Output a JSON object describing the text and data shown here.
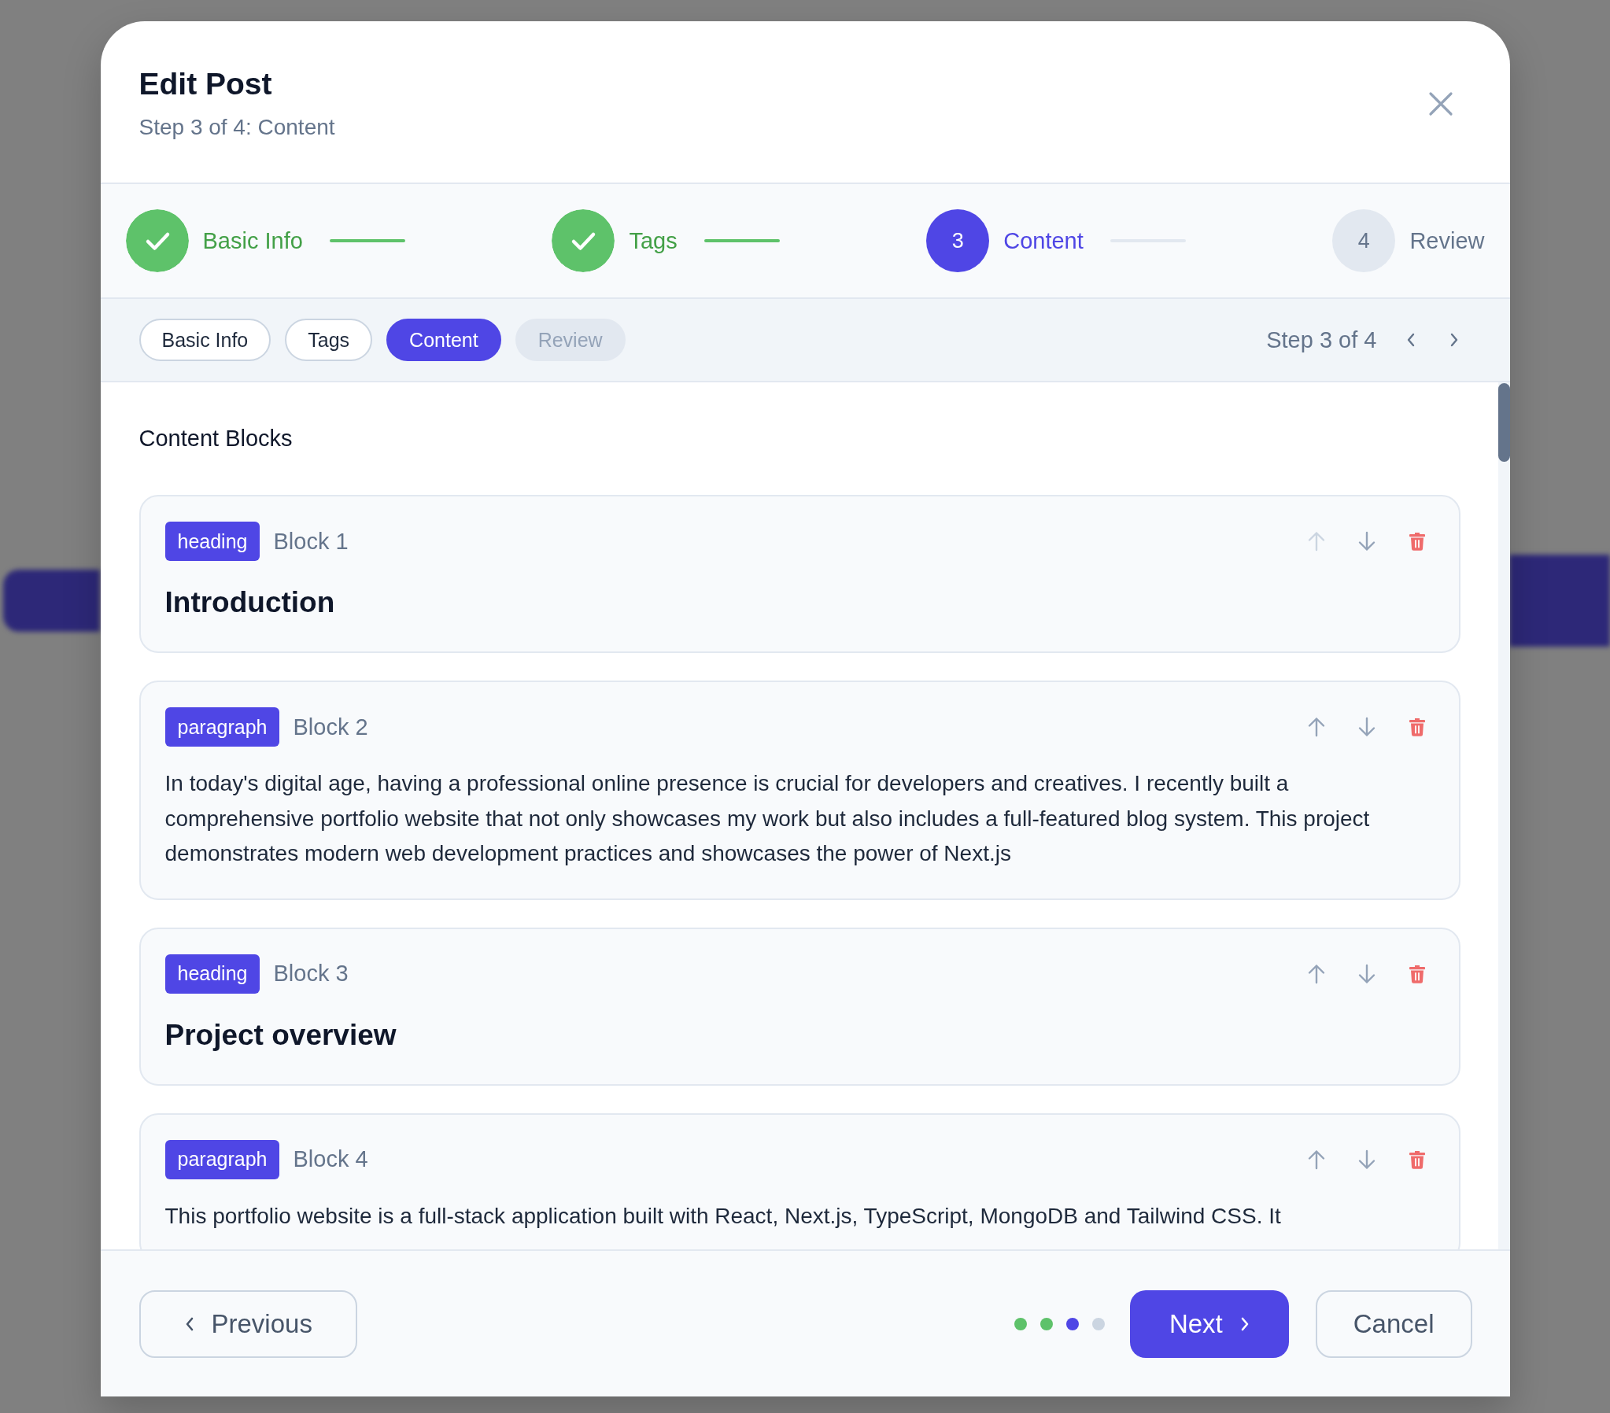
{
  "dialog": {
    "title": "Edit Post",
    "subtitle": "Step 3 of 4: Content"
  },
  "steps": [
    {
      "label": "Basic Info",
      "kind": "completed"
    },
    {
      "label": "Tags",
      "kind": "completed"
    },
    {
      "label": "Content",
      "kind": "current",
      "number": "3"
    },
    {
      "label": "Review",
      "kind": "upcoming",
      "number": "4"
    }
  ],
  "step_tabs": [
    {
      "label": "Basic Info",
      "selected": false,
      "disabled": false
    },
    {
      "label": "Tags",
      "selected": false,
      "disabled": false
    },
    {
      "label": "Content",
      "selected": true,
      "disabled": false
    },
    {
      "label": "Review",
      "selected": false,
      "disabled": true
    }
  ],
  "step_counter": "Step 3 of 4",
  "content": {
    "heading": "Content Blocks",
    "blocks": [
      {
        "kind": "heading",
        "badge": "heading",
        "label": "Block 1",
        "text": "Introduction",
        "up_disabled": true
      },
      {
        "kind": "paragraph",
        "badge": "paragraph",
        "label": "Block 2",
        "text": "In today's digital age, having a professional online presence is crucial for developers and creatives. I recently built a comprehensive portfolio website that not only showcases my work but also includes a full-featured blog system. This project demonstrates modern web development practices and showcases the power of Next.js",
        "up_disabled": false
      },
      {
        "kind": "heading",
        "badge": "heading",
        "label": "Block 3",
        "text": "Project overview",
        "up_disabled": false
      },
      {
        "kind": "paragraph",
        "badge": "paragraph",
        "label": "Block 4",
        "text": "This portfolio website is a full-stack application built with React, Next.js, TypeScript, MongoDB and Tailwind CSS. It",
        "up_disabled": false
      }
    ]
  },
  "footer": {
    "previous": "Previous",
    "next": "Next",
    "cancel": "Cancel"
  }
}
